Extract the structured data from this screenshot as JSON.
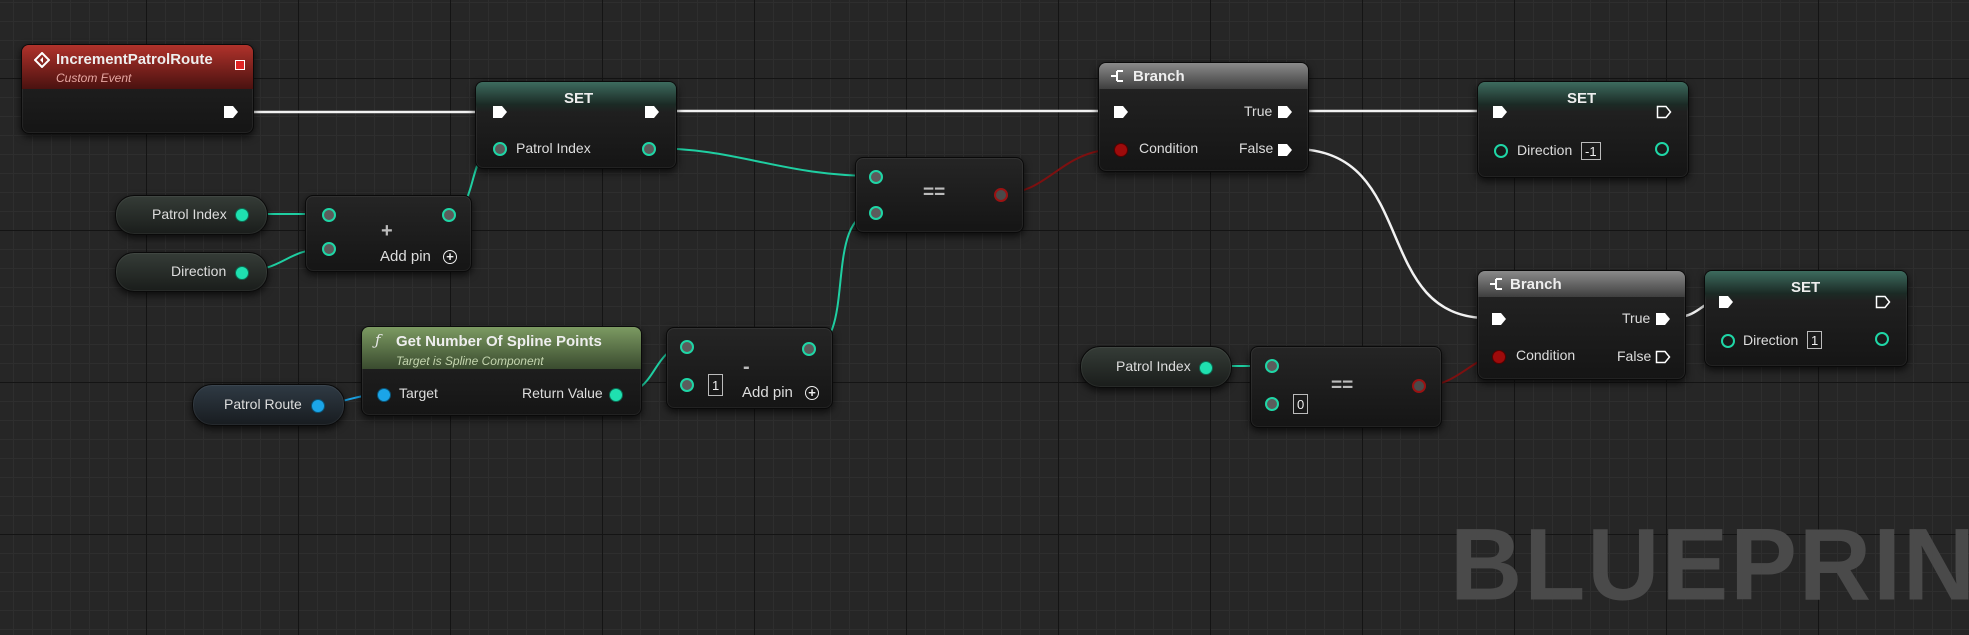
{
  "nodes": {
    "event": {
      "title": "IncrementPatrolRoute",
      "subtitle": "Custom Event"
    },
    "set1": {
      "title": "SET",
      "pin_label": "Patrol Index"
    },
    "var_patrol_index_1": {
      "label": "Patrol Index"
    },
    "var_direction": {
      "label": "Direction"
    },
    "add_node": {
      "symbol": "+",
      "add_pin_label": "Add pin"
    },
    "branch1": {
      "title": "Branch",
      "condition_label": "Condition",
      "true_label": "True",
      "false_label": "False"
    },
    "eq1": {
      "symbol": "=="
    },
    "set2": {
      "title": "SET",
      "pin_label": "Direction",
      "value": "-1"
    },
    "get_spline": {
      "title": "Get Number Of Spline Points",
      "subtitle": "Target is Spline Component",
      "target_label": "Target",
      "return_label": "Return Value"
    },
    "var_patrol_route": {
      "label": "Patrol Route"
    },
    "sub_node": {
      "symbol": "-",
      "value": "1",
      "add_pin_label": "Add pin"
    },
    "var_patrol_index_2": {
      "label": "Patrol Index"
    },
    "eq2": {
      "symbol": "==",
      "value": "0"
    },
    "branch2": {
      "title": "Branch",
      "condition_label": "Condition",
      "true_label": "True",
      "false_label": "False"
    },
    "set3": {
      "title": "SET",
      "pin_label": "Direction",
      "value": "1"
    }
  },
  "watermark": "BLUEPRINT",
  "colors": {
    "integer_pin": "#1fe0b0",
    "object_pin": "#1ba5e8",
    "boolean_pin": "#9e0b0b",
    "exec_wire": "#ffffff",
    "event_header": "#b0322b",
    "function_header": "#7c9a62",
    "set_header": "#3d6b5e"
  },
  "icons": {
    "event": "event-diamond-icon",
    "branch": "branch-icon",
    "function": "function-f-icon",
    "add_pin": "plus-circle-icon",
    "delegate": "delegate-square-icon"
  }
}
